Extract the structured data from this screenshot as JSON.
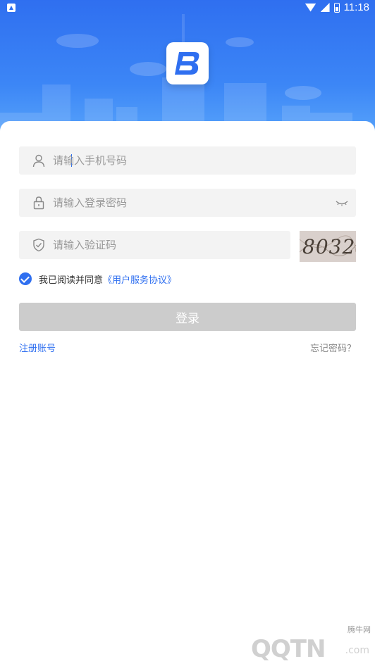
{
  "status_bar": {
    "time": "11:18",
    "icons": [
      "app-notification-icon",
      "wifi-icon",
      "cellular-icon",
      "battery-icon"
    ]
  },
  "header": {
    "logo_icon": "brand-logo-icon",
    "logo_letter": "B"
  },
  "form": {
    "phone": {
      "placeholder": "请输入手机号码",
      "value": "",
      "icon": "user-icon"
    },
    "password": {
      "placeholder": "请输入登录密码",
      "value": "",
      "icon": "lock-icon",
      "toggle_icon": "eye-closed-icon"
    },
    "captcha": {
      "placeholder": "请输入验证码",
      "value": "",
      "icon": "shield-icon",
      "image_text": "8032"
    }
  },
  "agreement": {
    "checked": true,
    "text": "我已阅读并同意",
    "link": "《用户服务协议》"
  },
  "login_button": {
    "label": "登录"
  },
  "links": {
    "register": "注册账号",
    "forgot": "忘记密码？"
  },
  "watermark": {
    "main": "QQTN",
    "sub": "腾牛网",
    "suffix": ".com"
  },
  "colors": {
    "brand": "#2f6ff0",
    "disabled_button": "#cccccc",
    "field_bg": "#f3f3f3"
  }
}
